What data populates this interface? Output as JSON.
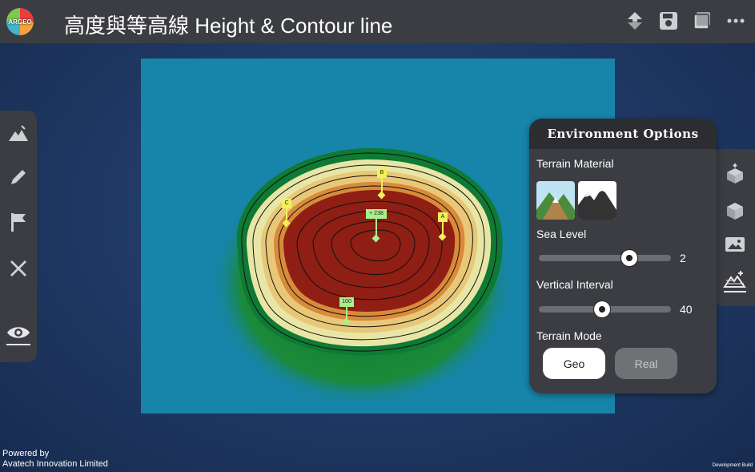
{
  "app": {
    "logo_text": "ARGEO",
    "title": "高度與等高線 Height & Contour line"
  },
  "top_actions": [
    "upload-download-icon",
    "save-icon",
    "book-icon",
    "more-icon"
  ],
  "left_tools": [
    "terrain-icon",
    "pencil-icon",
    "flag-icon",
    "measure-icon",
    "eye-icon"
  ],
  "right_tools": [
    "box-add-icon",
    "box-rotate-icon",
    "image-icon",
    "terrain-sparkle-icon"
  ],
  "map": {
    "markers": [
      {
        "label": "B"
      },
      {
        "label": "C"
      },
      {
        "label": "A"
      },
      {
        "label": "+ 238"
      },
      {
        "label": "100"
      }
    ]
  },
  "env_options": {
    "title": "Environment Options",
    "terrain_material_label": "Terrain Material",
    "sea_level_label": "Sea Level",
    "sea_level_value": "2",
    "sea_level_fraction": 0.7,
    "vertical_interval_label": "Vertical Interval",
    "vertical_interval_value": "40",
    "vertical_interval_fraction": 0.48,
    "terrain_mode_label": "Terrain Mode",
    "mode_geo": "Geo",
    "mode_real": "Real",
    "selected_mode": "Geo"
  },
  "footer": {
    "powered_line1": "Powered by",
    "powered_line2": "Avatech Innovation Limited",
    "dev_build": "Development Build"
  },
  "colors": {
    "topbar": "#3b3d42",
    "sea": "#1784a9",
    "background": "#1f3863"
  }
}
